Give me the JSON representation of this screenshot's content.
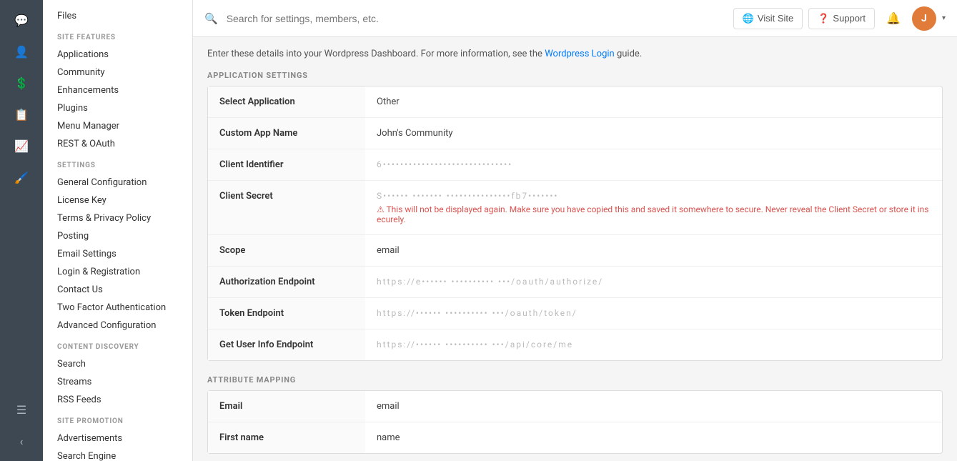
{
  "icon_sidebar": {
    "items": [
      {
        "name": "chat-icon",
        "icon": "💬",
        "active": false
      },
      {
        "name": "user-icon",
        "icon": "👤",
        "active": false
      },
      {
        "name": "dollar-icon",
        "icon": "💲",
        "active": false
      },
      {
        "name": "copy-icon",
        "icon": "📋",
        "active": false
      },
      {
        "name": "chart-icon",
        "icon": "📈",
        "active": false
      },
      {
        "name": "brush-icon",
        "icon": "🖌️",
        "active": false
      }
    ],
    "bottom_items": [
      {
        "name": "menu-icon",
        "icon": "☰"
      },
      {
        "name": "collapse-icon",
        "icon": "‹"
      }
    ]
  },
  "sidebar": {
    "site_features_title": "SITE FEATURES",
    "site_features_items": [
      {
        "label": "Applications",
        "active": false
      },
      {
        "label": "Community",
        "active": false
      },
      {
        "label": "Enhancements",
        "active": false
      },
      {
        "label": "Plugins",
        "active": false
      },
      {
        "label": "Menu Manager",
        "active": false
      },
      {
        "label": "REST & OAuth",
        "active": false
      }
    ],
    "settings_title": "SETTINGS",
    "settings_items": [
      {
        "label": "General Configuration",
        "active": false
      },
      {
        "label": "License Key",
        "active": false
      },
      {
        "label": "Terms & Privacy Policy",
        "active": false
      },
      {
        "label": "Posting",
        "active": false
      },
      {
        "label": "Email Settings",
        "active": false
      },
      {
        "label": "Login & Registration",
        "active": false
      },
      {
        "label": "Contact Us",
        "active": false
      },
      {
        "label": "Two Factor Authentication",
        "active": false
      },
      {
        "label": "Advanced Configuration",
        "active": false
      }
    ],
    "content_discovery_title": "CONTENT DISCOVERY",
    "content_discovery_items": [
      {
        "label": "Search",
        "active": false
      },
      {
        "label": "Streams",
        "active": false
      },
      {
        "label": "RSS Feeds",
        "active": false
      }
    ],
    "site_promotion_title": "SITE PROMOTION",
    "site_promotion_items": [
      {
        "label": "Advertisements",
        "active": false
      },
      {
        "label": "Search Engine",
        "active": false
      }
    ]
  },
  "topbar": {
    "search_placeholder": "Search for settings, members, etc.",
    "visit_site_label": "Visit Site",
    "support_label": "Support",
    "avatar_initials": "J"
  },
  "content": {
    "intro_text": "Enter these details into your Wordpress Dashboard. For more information, see the",
    "intro_link_text": "Wordpress Login",
    "intro_text_suffix": "guide.",
    "app_settings_heading": "APPLICATION SETTINGS",
    "app_settings_rows": [
      {
        "label": "Select Application",
        "value": "Other",
        "blurred": false
      },
      {
        "label": "Custom App Name",
        "value": "John's Community",
        "blurred": false
      },
      {
        "label": "Client Identifier",
        "value": "6••••••••••••••••••••••••••••••",
        "blurred": true
      },
      {
        "label": "Client Secret",
        "value": "S•••••• ••••••• •••••••••••••••fb7•••••••",
        "blurred": true,
        "warning": true,
        "warning_text": "⚠ This will not be displayed again. Make sure you have copied this and saved it somewhere to secure. Never reveal the Client Secret or store it insecurely."
      },
      {
        "label": "Scope",
        "value": "email",
        "blurred": false
      },
      {
        "label": "Authorization Endpoint",
        "value": "https://e•••••• •••••••••• •••/oauth/authorize/",
        "blurred": true
      },
      {
        "label": "Token Endpoint",
        "value": "https://•••••• •••••••••• •••/oauth/token/",
        "blurred": true
      },
      {
        "label": "Get User Info Endpoint",
        "value": "https://•••••• •••••••••• •••/api/core/me",
        "blurred": true
      }
    ],
    "attribute_mapping_heading": "ATTRIBUTE MAPPING",
    "attribute_mapping_rows": [
      {
        "label": "Email",
        "value": "email"
      },
      {
        "label": "First name",
        "value": "name"
      }
    ]
  }
}
